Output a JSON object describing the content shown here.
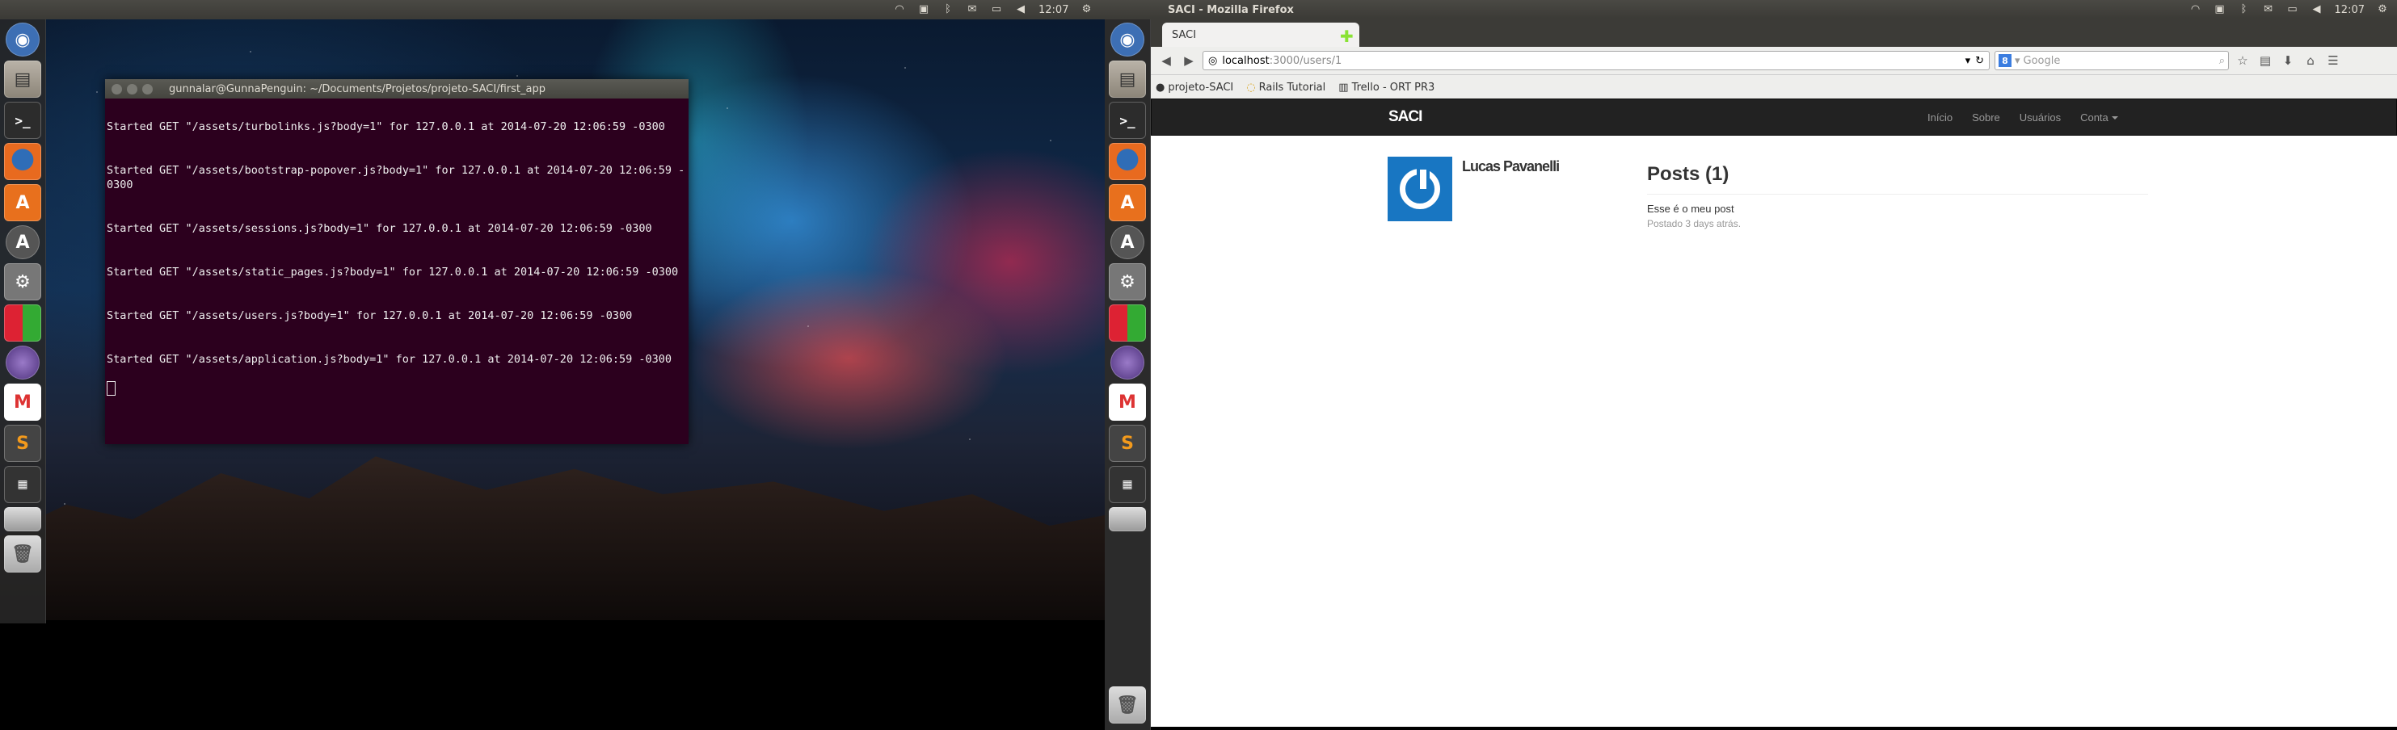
{
  "panel_left": {
    "clock": "12:07"
  },
  "panel_right": {
    "window_title": "SACI - Mozilla Firefox",
    "clock": "12:07"
  },
  "launcher": {
    "items": [
      "Dash",
      "Files",
      "Terminal",
      "Firefox",
      "Software Center",
      "Update Manager",
      "System Settings",
      "LibreOffice",
      "Eclipse",
      "Gmail",
      "Sublime Text",
      "Workspace Switcher",
      "Drive",
      "Trash"
    ]
  },
  "terminal": {
    "title": "gunnalar@GunnaPenguin: ~/Documents/Projetos/projeto-SACI/first_app",
    "lines": [
      "Started GET \"/assets/turbolinks.js?body=1\" for 127.0.0.1 at 2014-07-20 12:06:59 -0300",
      "Started GET \"/assets/bootstrap-popover.js?body=1\" for 127.0.0.1 at 2014-07-20 12:06:59 -0300",
      "Started GET \"/assets/sessions.js?body=1\" for 127.0.0.1 at 2014-07-20 12:06:59 -0300",
      "Started GET \"/assets/static_pages.js?body=1\" for 127.0.0.1 at 2014-07-20 12:06:59 -0300",
      "Started GET \"/assets/users.js?body=1\" for 127.0.0.1 at 2014-07-20 12:06:59 -0300",
      "Started GET \"/assets/application.js?body=1\" for 127.0.0.1 at 2014-07-20 12:06:59 -0300"
    ]
  },
  "browser": {
    "tab_title": "SACI",
    "url_host": "localhost",
    "url_path": ":3000/users/1",
    "search_placeholder": "Google",
    "bookmarks": [
      "projeto-SACI",
      "Rails Tutorial",
      "Trello - ORT PR3"
    ]
  },
  "app": {
    "brand": "SACI",
    "nav": [
      "Início",
      "Sobre",
      "Usuários",
      "Conta"
    ],
    "user_name": "Lucas Pavanelli",
    "posts_heading": "Posts (1)",
    "post_content": "Esse é o meu post",
    "post_time": "Postado 3 days atrás."
  }
}
